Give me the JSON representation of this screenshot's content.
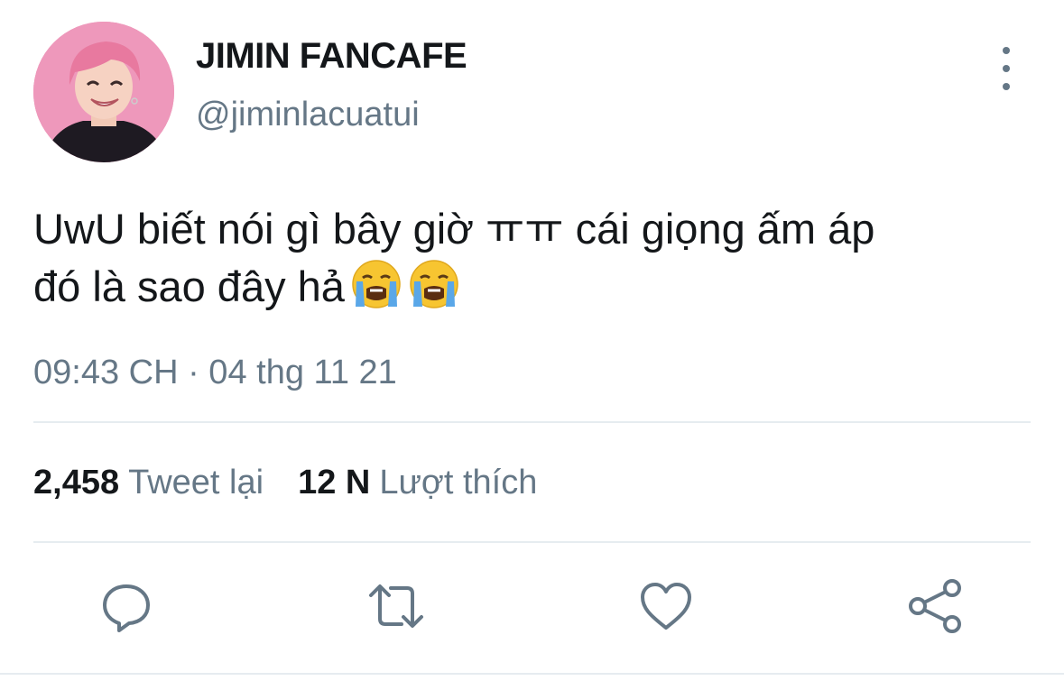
{
  "author": {
    "display_name": "JIMIN FANCAFE",
    "handle": "@jiminlacuatui"
  },
  "tweet": {
    "line1": "UwU biết nói gì bây giờ ㅠㅠ cái giọng ấm áp",
    "line2": "đó là sao đây hả",
    "emojis": [
      "loudly-crying-face",
      "loudly-crying-face"
    ],
    "timestamp": "09:43 CH · 04 thg 11 21"
  },
  "stats": {
    "retweets_count": "2,458",
    "retweets_label": "Tweet lại",
    "likes_count": "12 N",
    "likes_label": "Lượt thích"
  },
  "actions": {
    "icons": [
      "reply-icon",
      "retweet-icon",
      "like-icon",
      "share-icon"
    ]
  },
  "colors": {
    "text_primary": "#14171a",
    "text_secondary": "#657786",
    "divider": "#e6ecf0",
    "icon": "#657786"
  }
}
